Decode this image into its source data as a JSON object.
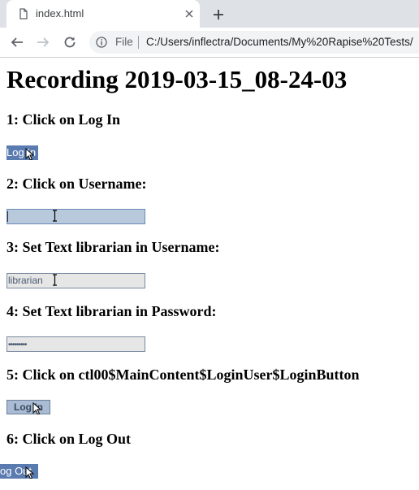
{
  "browser": {
    "tab_title": "index.html",
    "scheme_label": "File",
    "url": "C:/Users/inflectra/Documents/My%20Rapise%20Tests/",
    "icons": {
      "tab": "document-icon",
      "close": "close-icon",
      "new_tab": "plus-icon",
      "back": "back-arrow-icon",
      "forward": "forward-arrow-icon",
      "reload": "reload-icon",
      "info": "info-icon"
    }
  },
  "page": {
    "title": "Recording 2019-03-15_08-24-03",
    "steps": [
      {
        "heading": "1: Click on Log In",
        "shot_text": "Log In"
      },
      {
        "heading": "2: Click on Username:",
        "shot_text": ""
      },
      {
        "heading": "3: Set Text librarian in Username:",
        "shot_text": "librarian"
      },
      {
        "heading": "4: Set Text librarian in Password:",
        "shot_text": "•••••••••"
      },
      {
        "heading": "5: Click on ctl00$MainContent$LoginUser$LoginButton",
        "shot_text": "Log In"
      },
      {
        "heading": "6: Click on Log Out",
        "shot_text": "og Out"
      }
    ]
  },
  "colors": {
    "tabstrip": "#dee1e6",
    "blue_button": "#5a7bb0",
    "active_field": "#b8c9dc",
    "inactive_field": "#e6e6e6",
    "grey_button": "#a9bcd4"
  }
}
